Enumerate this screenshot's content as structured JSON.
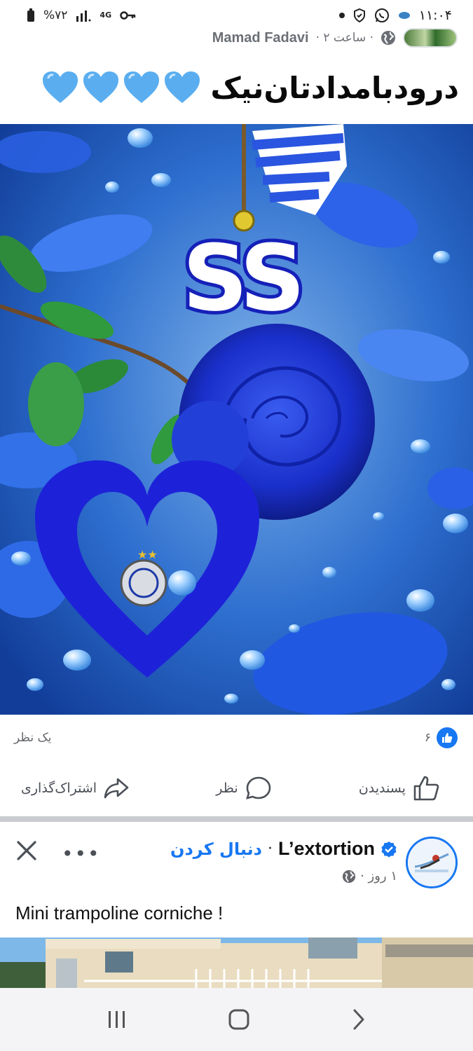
{
  "status_bar": {
    "time": "۱۱:۰۴",
    "battery": "%۷۲",
    "network": "4G"
  },
  "post1": {
    "author": "Mamad Fadavi",
    "time_ago": "· ساعت ۲ ·",
    "greeting": "درودبامدادتان‌نیک",
    "hearts": [
      "blue-heart",
      "blue-heart",
      "blue-heart",
      "blue-heart"
    ],
    "image_text": "SS",
    "reactions_count": "۶",
    "comments_count": "یک نظر",
    "actions": {
      "like": "پسندیدن",
      "comment": "نظر",
      "share": "اشتراک‌گذاری"
    }
  },
  "post2": {
    "author": "L’extortion",
    "follow_label": "دنبال کردن",
    "separator": "·",
    "time_ago": "۱ روز ·",
    "caption": "Mini trampoline corniche !",
    "more_label": "•••"
  },
  "colors": {
    "accent": "#1877f2",
    "image_blue": "#1e5fe0"
  },
  "nav": [
    "recent-apps-icon",
    "home-icon",
    "back-icon"
  ]
}
